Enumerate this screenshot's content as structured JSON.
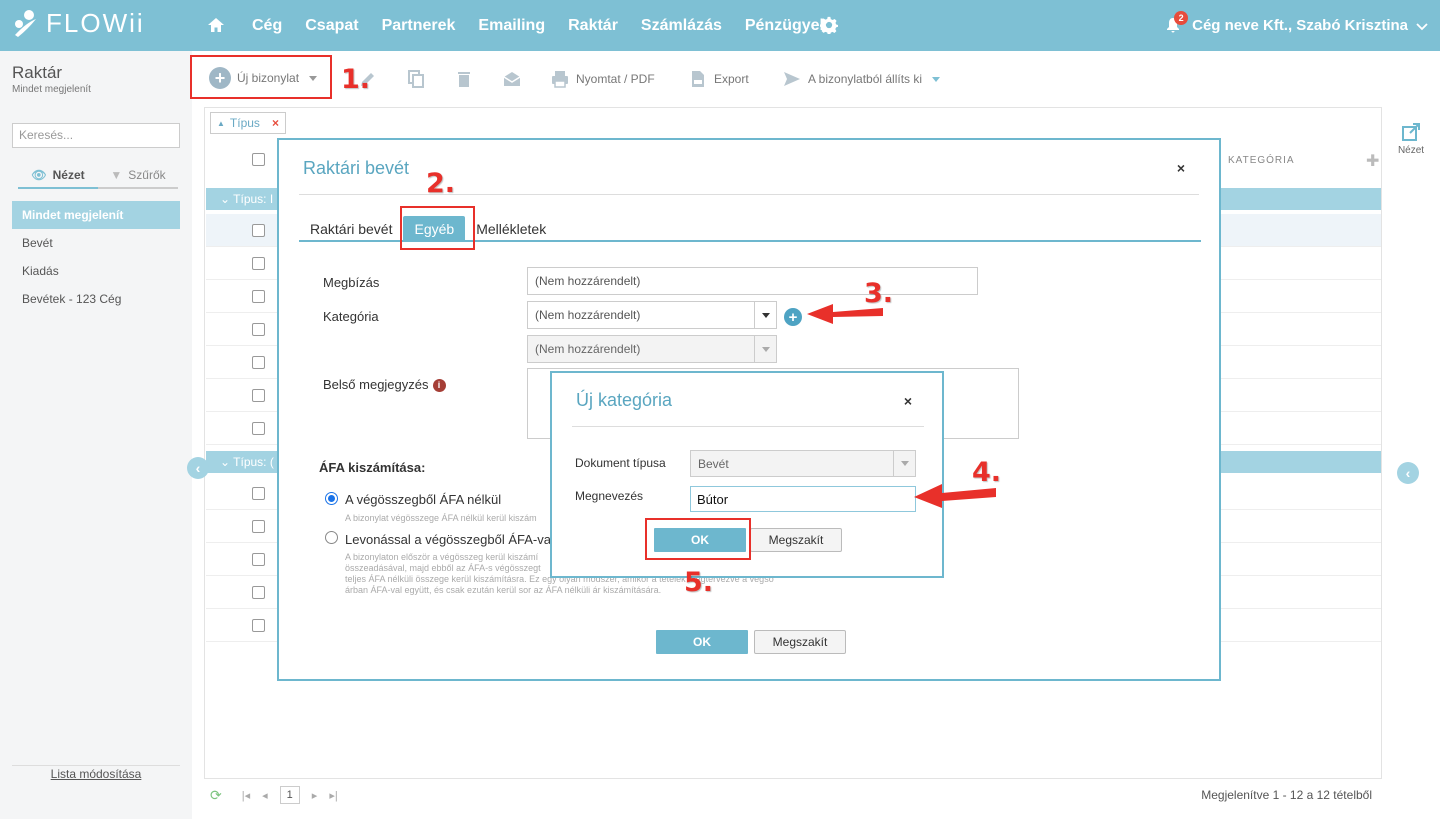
{
  "app": {
    "logo_text": "FLOWii",
    "nav": [
      "Cég",
      "Csapat",
      "Partnerek",
      "Emailing",
      "Raktár",
      "Számlázás",
      "Pénzügyek"
    ],
    "notification_count": "2",
    "user": "Cég neve Kft., Szabó Krisztina"
  },
  "sidebar": {
    "module_title": "Raktár",
    "module_subtitle": "Mindet megjelenít",
    "search_placeholder": "Keresés...",
    "view_tab": "Nézet",
    "filter_tab": "Szűrők",
    "items": [
      "Mindet megjelenít",
      "Bevét",
      "Kiadás",
      "Bevétek - 123 Cég"
    ],
    "list_edit": "Lista módosítása"
  },
  "toolbar": {
    "new_doc": "Új bizonylat",
    "print": "Nyomtat / PDF",
    "export": "Export",
    "issue_from": "A bizonylatból állíts ki"
  },
  "table": {
    "filter_chip": "Típus",
    "col_category": "KATEGÓRIA",
    "group1": "Típus: I",
    "group2": "Típus: (",
    "view_label": "Nézet",
    "page": "1",
    "pager_info": "Megjelenítve 1 - 12 a 12 tételből"
  },
  "modal": {
    "title": "Raktári bevét",
    "close": "×",
    "tabs": [
      "Raktári bevét",
      "Egyéb",
      "Mellékletek"
    ],
    "fields": {
      "assignment_label": "Megbízás",
      "assignment_value": "(Nem hozzárendelt)",
      "category_label": "Kategória",
      "category_value": "(Nem hozzárendelt)",
      "subcategory_value": "(Nem hozzárendelt)",
      "internal_note_label": "Belső megjegyzés"
    },
    "vat": {
      "title": "ÁFA kiszámítása:",
      "option1": "A végösszegből ÁFA nélkül",
      "option1_note": "A bizonylat végösszege ÁFA nélkül kerül kiszám",
      "option2": "Levonással a végösszegből ÁFA-val",
      "option2_note_1": "A bizonylaton először a végösszeg kerül kiszámí",
      "option2_note_2": "összeadásával, majd ebből az ÁFA-s végösszegt",
      "option2_note_3": "teljes ÁFA nélküli összege kerül kiszámításra. Ez egy olyan módszer, amikor a tételek megtervezve a végső",
      "option2_note_4": "árban ÁFA-val együtt, és csak ezután kerül sor az ÁFA nélküli ár kiszámítására."
    },
    "ok": "OK",
    "cancel": "Megszakít"
  },
  "submodal": {
    "title": "Új kategória",
    "close": "×",
    "doc_type_label": "Dokument típusa",
    "doc_type_value": "Bevét",
    "name_label": "Megnevezés",
    "name_value": "Bútor",
    "ok": "OK",
    "cancel": "Megszakít"
  },
  "annotations": {
    "step1": "1.",
    "step2": "2.",
    "step3": "3.",
    "step4": "4.",
    "step5": "5.",
    "color": "#e8302a"
  }
}
